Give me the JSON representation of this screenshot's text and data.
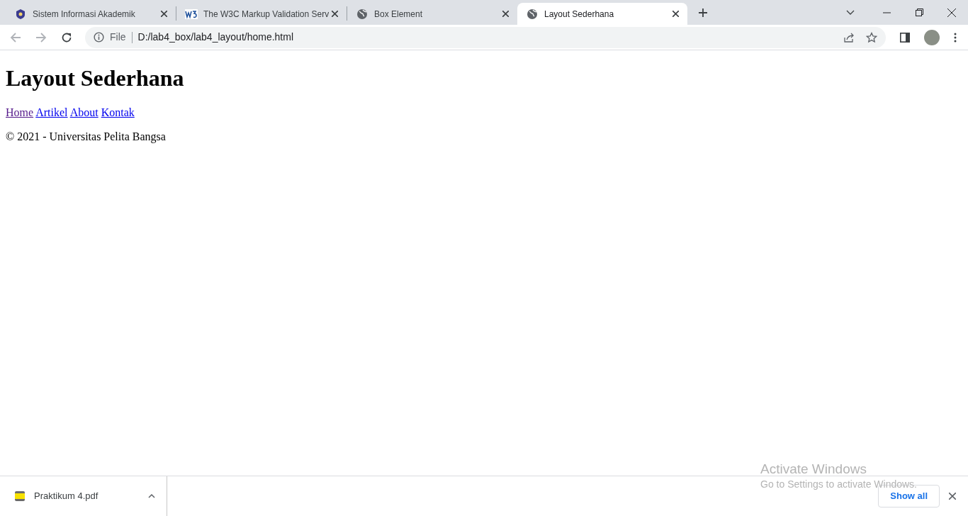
{
  "tabs": [
    {
      "title": "Sistem Informasi Akademik",
      "kind": "crest",
      "selected": false
    },
    {
      "title": "The W3C Markup Validation Serv",
      "kind": "w3c",
      "selected": false
    },
    {
      "title": "Box Element",
      "kind": "globe",
      "selected": false
    },
    {
      "title": "Layout Sederhana",
      "kind": "globe",
      "selected": true
    }
  ],
  "address_bar": {
    "scheme_label": "File",
    "url": "D:/lab4_box/lab4_layout/home.html"
  },
  "page": {
    "heading": "Layout Sederhana",
    "nav_links": [
      {
        "label": "Home",
        "visited": true
      },
      {
        "label": "Artikel",
        "visited": false
      },
      {
        "label": "About",
        "visited": false
      },
      {
        "label": "Kontak",
        "visited": false
      }
    ],
    "footer": "© 2021 - Universitas Pelita Bangsa"
  },
  "download_bar": {
    "file": "Praktikum 4.pdf",
    "show_all": "Show all"
  },
  "os_notice": {
    "title": "Activate Windows",
    "subtitle": "Go to Settings to activate Windows."
  }
}
